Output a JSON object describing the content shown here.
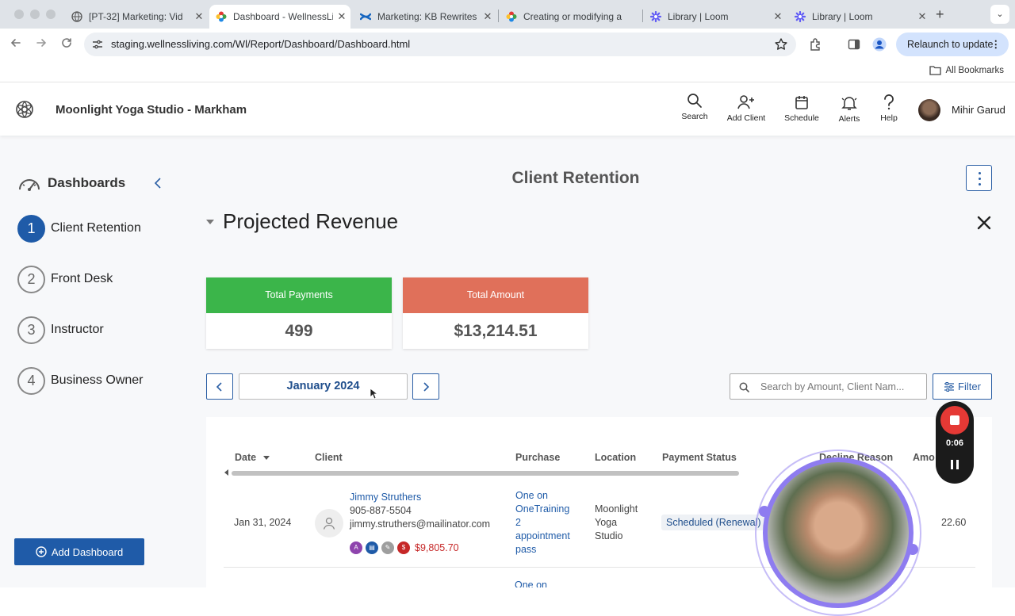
{
  "browser": {
    "tabs": [
      {
        "title": "[PT-32] Marketing: Vid",
        "icon": "globe-icon",
        "active": false
      },
      {
        "title": "Dashboard - WellnessLi",
        "icon": "wellnessliving-icon",
        "active": true
      },
      {
        "title": "Marketing: KB Rewrites",
        "icon": "confluence-icon",
        "active": false
      },
      {
        "title": "Creating or modifying a",
        "icon": "wellnessliving-icon",
        "active": false
      },
      {
        "title": "Library | Loom",
        "icon": "loom-icon",
        "active": false
      },
      {
        "title": "Library | Loom",
        "icon": "loom-icon",
        "active": false
      }
    ],
    "url": "staging.wellnessliving.com/Wl/Report/Dashboard/Dashboard.html",
    "relaunch_label": "Relaunch to update",
    "bookmarks_label": "All Bookmarks"
  },
  "header": {
    "studio_name": "Moonlight Yoga Studio - Markham",
    "nav": [
      {
        "label": "Search",
        "icon": "search-icon"
      },
      {
        "label": "Add Client",
        "icon": "add-user-icon"
      },
      {
        "label": "Schedule",
        "icon": "calendar-icon"
      },
      {
        "label": "Alerts",
        "icon": "bell-icon"
      },
      {
        "label": "Help",
        "icon": "help-icon"
      }
    ],
    "user_name": "Mihir Garud"
  },
  "sidebar": {
    "title": "Dashboards",
    "items": [
      {
        "number": "1",
        "label": "Client Retention",
        "active": true
      },
      {
        "number": "2",
        "label": "Front Desk",
        "active": false
      },
      {
        "number": "3",
        "label": "Instructor",
        "active": false
      },
      {
        "number": "4",
        "label": "Business Owner",
        "active": false
      }
    ],
    "add_button": "Add Dashboard"
  },
  "main": {
    "page_title": "Client Retention",
    "section_title": "Projected Revenue",
    "kpis": [
      {
        "label": "Total Payments",
        "value": "499",
        "color": "#3bb54a"
      },
      {
        "label": "Total Amount",
        "value": "$13,214.51",
        "color": "#e0705a"
      }
    ],
    "month": "January 2024",
    "search_placeholder": "Search by Amount, Client Nam...",
    "filter_label": "Filter",
    "table": {
      "columns": [
        "Date",
        "Client",
        "Purchase",
        "Location",
        "Payment Status",
        "Decline Reason",
        "Amo"
      ],
      "rows": [
        {
          "date": "Jan 31, 2024",
          "client_name": "Jimmy Struthers",
          "phone": "905-887-5504",
          "email": "jimmy.struthers@mailinator.com",
          "badge_a": "A",
          "balance": "$9,805.70",
          "purchase": [
            "One on",
            "OneTraining",
            "2",
            "appointment",
            "pass"
          ],
          "location": [
            "Moonlight",
            "Yoga",
            "Studio"
          ],
          "status": "Scheduled (Renewal)",
          "amount": "22.60"
        }
      ],
      "next_row_purchase_partial": "One on"
    }
  },
  "loom": {
    "timer": "0:06"
  }
}
